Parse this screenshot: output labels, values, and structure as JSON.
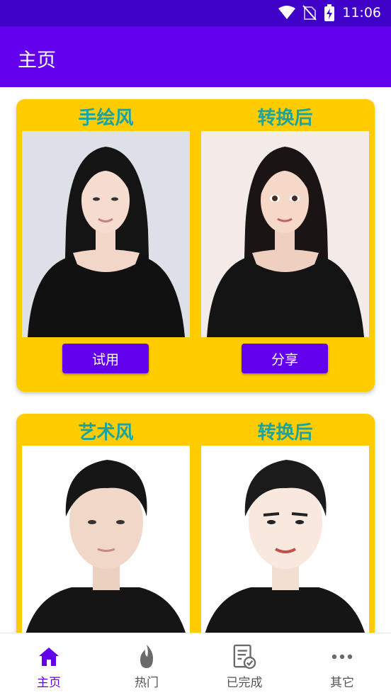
{
  "status_bar": {
    "time": "11:06"
  },
  "app_bar": {
    "title": "主页"
  },
  "cards": [
    {
      "style_label": "手绘风",
      "result_label": "转换后",
      "action_label": "试用",
      "share_label": "分享"
    },
    {
      "style_label": "艺术风",
      "result_label": "转换后"
    }
  ],
  "bottom_nav": {
    "items": [
      {
        "label": "主页",
        "icon": "home-icon",
        "active": true
      },
      {
        "label": "热门",
        "icon": "flame-icon",
        "active": false
      },
      {
        "label": "已完成",
        "icon": "completed-document-icon",
        "active": false
      },
      {
        "label": "其它",
        "icon": "more-icon",
        "active": false
      }
    ]
  },
  "colors": {
    "primary": "#6200ee",
    "status_bar": "#3f00c8",
    "card": "#ffcc00",
    "label": "#1aa3a0"
  }
}
